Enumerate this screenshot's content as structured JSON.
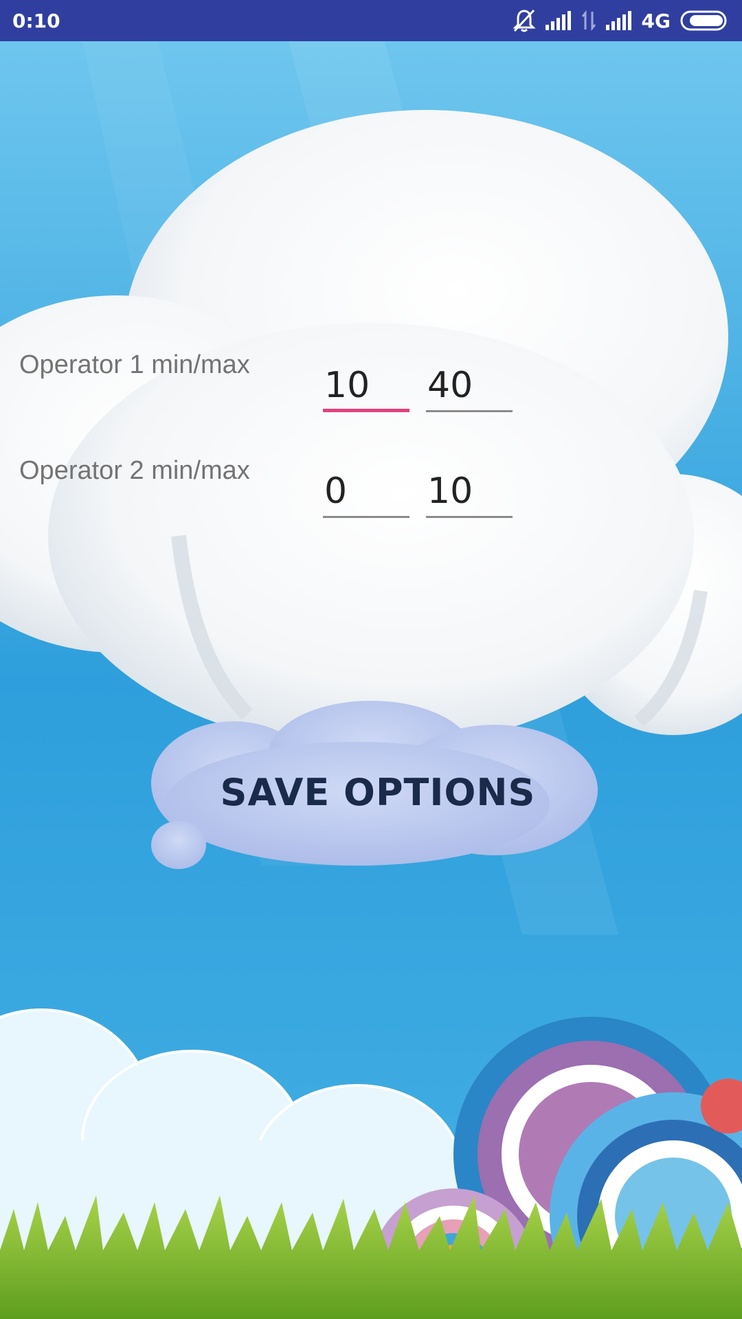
{
  "status_bar": {
    "time": "0:10",
    "network_label": "4G",
    "icons": [
      "notifications-off-icon",
      "signal-icon",
      "data-transfer-icon",
      "signal-icon",
      "battery-icon"
    ]
  },
  "form": {
    "rows": [
      {
        "label": "Operator 1 min/max",
        "min": "10",
        "max": "40"
      },
      {
        "label": "Operator 2 min/max",
        "min": "0",
        "max": "10"
      }
    ]
  },
  "save_button": {
    "label": "SAVE OPTIONS"
  },
  "colors": {
    "status_bar": "#303f9f",
    "sky": "#2a9ad6",
    "focus_underline": "#e4407d",
    "button_cloud": "#bccbf0"
  }
}
